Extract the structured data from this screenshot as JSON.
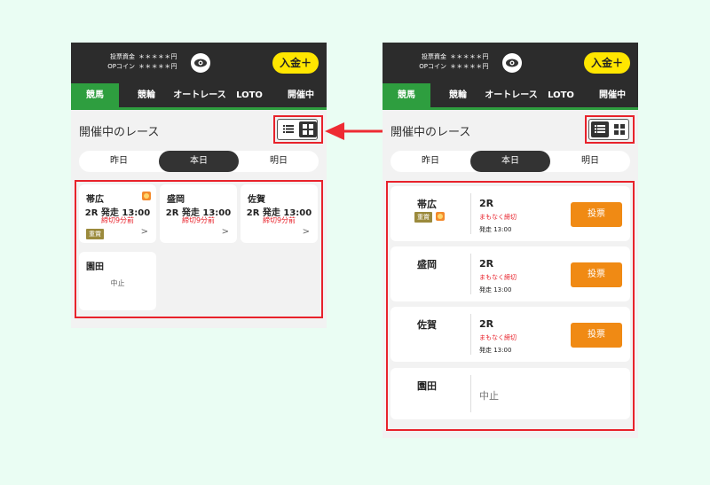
{
  "header": {
    "stake_label": "投票資金",
    "stake_value": "＊＊＊＊＊円",
    "coin_label": "OPコイン",
    "coin_value": "＊＊＊＊＊円",
    "deposit_label": "入金＋"
  },
  "tabs": [
    "競馬",
    "競輪",
    "オートレース",
    "LOTO",
    "開催中"
  ],
  "section_title": "開催中のレース",
  "days": [
    "昨日",
    "本日",
    "明日"
  ],
  "grid_cards": [
    {
      "venue": "帯広",
      "race": "2R 発走 13:00",
      "deadline": "締切9分前",
      "badge": "重賞"
    },
    {
      "venue": "盛岡",
      "race": "2R 発走 13:00",
      "deadline": "締切9分前"
    },
    {
      "venue": "佐賀",
      "race": "2R 発走 13:00",
      "deadline": "締切9分前"
    },
    {
      "venue": "園田",
      "status": "中止"
    }
  ],
  "list_cards": [
    {
      "venue": "帯広",
      "badge": "重賞",
      "race": "2R",
      "deadline": "まもなく締切",
      "start": "発走 13:00",
      "button": "投票"
    },
    {
      "venue": "盛岡",
      "race": "2R",
      "deadline": "まもなく締切",
      "start": "発走 13:00",
      "button": "投票"
    },
    {
      "venue": "佐賀",
      "race": "2R",
      "deadline": "まもなく締切",
      "start": "発走 13:00",
      "button": "投票"
    },
    {
      "venue": "園田",
      "status": "中止"
    }
  ],
  "colors": {
    "accent_green": "#2e9e3f",
    "highlight_red": "#e8222b",
    "vote_orange": "#f08a14",
    "deposit_yellow": "#ffe600"
  }
}
